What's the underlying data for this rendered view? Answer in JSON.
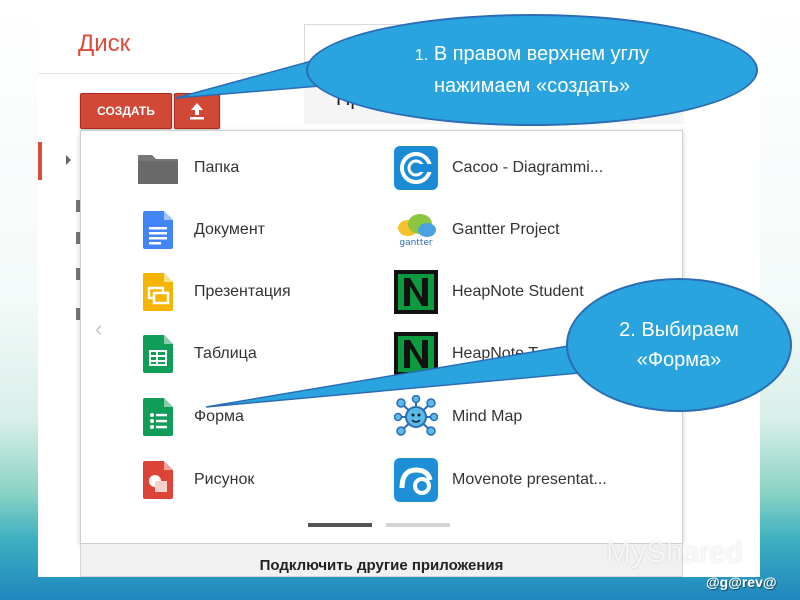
{
  "header": {
    "logo": "Диск",
    "preview_title": "Предст"
  },
  "toolbar": {
    "create_label": "СОЗДАТЬ",
    "upload_icon": "upload-icon"
  },
  "apps_left": [
    {
      "label": "Папка",
      "icon": "folder-icon",
      "color": "#6e6e6e"
    },
    {
      "label": "Документ",
      "icon": "docs-icon",
      "color": "#4285f4"
    },
    {
      "label": "Презентация",
      "icon": "slides-icon",
      "color": "#f4b400"
    },
    {
      "label": "Таблица",
      "icon": "sheets-icon",
      "color": "#0f9d58"
    },
    {
      "label": "Форма",
      "icon": "forms-icon",
      "color": "#0f9d58"
    },
    {
      "label": "Рисунок",
      "icon": "drawings-icon",
      "color": "#db4437"
    }
  ],
  "apps_right": [
    {
      "label": "Cacoo - Diagrammi...",
      "icon": "cacoo-icon",
      "color": "#1a8ad4"
    },
    {
      "label": "Gantter Project",
      "icon": "gantter-icon",
      "color": "#4aa3df"
    },
    {
      "label": "HeapNote Student",
      "icon": "heapnote-icon",
      "color": "#0c9a3f"
    },
    {
      "label": "HeapNote T",
      "icon": "heapnote-icon",
      "color": "#0c9a3f"
    },
    {
      "label": "Mind Map",
      "icon": "mindmap-icon",
      "color": "#36a3d8"
    },
    {
      "label": "Movenote presentat...",
      "icon": "movenote-icon",
      "color": "#1d8fd6"
    }
  ],
  "footer": {
    "connect_label": "Подключить другие приложения"
  },
  "callouts": {
    "step1_num": "1.",
    "step1_line1": "В правом верхнем углу",
    "step1_line2": "нажимаем «создать»",
    "step2_line1": "2. Выбираем",
    "step2_line2": "«Форма»"
  },
  "watermark": "MyShared",
  "author": "@g@rev@",
  "colors": {
    "accent_red": "#d14836",
    "callout_blue": "#2aa4de"
  }
}
